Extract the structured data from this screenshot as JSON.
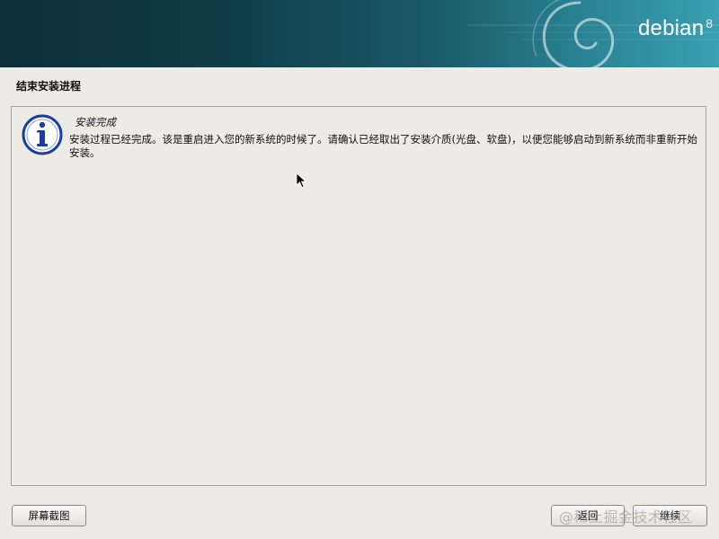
{
  "header": {
    "brand": "debian",
    "version": "8"
  },
  "page": {
    "title": "结束安装进程"
  },
  "message": {
    "title": "安装完成",
    "body": "安装过程已经完成。该是重启进入您的新系统的时候了。请确认已经取出了安装介质(光盘、软盘)，以便您能够启动到新系统而非重新开始安装。",
    "icon": "info-icon"
  },
  "buttons": {
    "screenshot": "屏幕截图",
    "back": "返回",
    "continue": "继续"
  },
  "watermark": {
    "text": "@稀土掘金技术社区"
  },
  "colors": {
    "banner_dark": "#0c2f3a",
    "banner_light": "#3aa0b1",
    "background": "#edebe6",
    "icon_blue": "#1a3fa0"
  }
}
